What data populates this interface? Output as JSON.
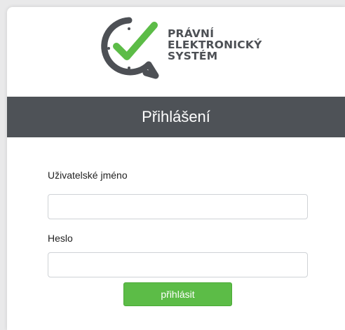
{
  "logo": {
    "line1": "PRÁVNÍ",
    "line2": "ELEKTRONICKÝ",
    "line3": "SYSTÉM"
  },
  "header": {
    "title": "Přihlášení"
  },
  "form": {
    "username_label": "Uživatelské jméno",
    "username_value": "",
    "password_label": "Heslo",
    "password_value": "",
    "submit_label": "přihlásit"
  },
  "colors": {
    "brand_green": "#5cbc47",
    "header_band": "#4e5257",
    "logo_gray": "#4d5055"
  }
}
